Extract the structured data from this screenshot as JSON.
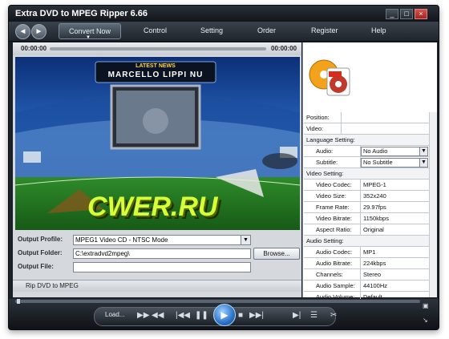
{
  "window": {
    "title": "Extra DVD to MPEG Ripper 6.66",
    "controls": {
      "minimize": "_",
      "maximize": "□",
      "close": "×"
    }
  },
  "menu": {
    "back_icon": "◄",
    "forward_icon": "►",
    "items": [
      {
        "label": "Convert Now"
      },
      {
        "label": "Control"
      },
      {
        "label": "Setting"
      },
      {
        "label": "Order"
      },
      {
        "label": "Register"
      },
      {
        "label": "Help"
      }
    ]
  },
  "player": {
    "time_start": "00:00:00",
    "time_end": "00:00:00",
    "news_banner_title": "LATEST NEWS",
    "news_banner_text": "MARCELLO LIPPI NU",
    "watermark_text": "CWER.RU"
  },
  "output": {
    "profile_label": "Output Profile:",
    "profile_value": "MPEG1  Video CD - NTSC Mode",
    "folder_label": "Output Folder:",
    "folder_value": "C:\\extradvd2mpeg\\",
    "file_label": "Output File:",
    "file_value": "",
    "browse_label": "Browse..."
  },
  "status": {
    "text": "Rip DVD to MPEG"
  },
  "properties": {
    "position_label": "Position:",
    "position_value": "",
    "video_label": "Video:",
    "video_value": "",
    "language_section": "Language Setting:",
    "audio_label": "Audio:",
    "audio_value": "No Audio",
    "subtitle_label": "Subtitle:",
    "subtitle_value": "No Subtitle",
    "video_section": "Video Setting:",
    "video_rows": [
      {
        "k": "Video Codec:",
        "v": "MPEG-1"
      },
      {
        "k": "Video Size:",
        "v": "352x240"
      },
      {
        "k": "Frame Rate:",
        "v": "29.97fps"
      },
      {
        "k": "Video Bitrate:",
        "v": "1150kbps"
      },
      {
        "k": "Aspect Ratio:",
        "v": "Original"
      }
    ],
    "audio_section": "Audio Setting:",
    "audio_rows": [
      {
        "k": "Audio Codec:",
        "v": "MP1"
      },
      {
        "k": "Audio Bitrate:",
        "v": "224kbps"
      },
      {
        "k": "Channels:",
        "v": "Stereo"
      },
      {
        "k": "Audio Sample:",
        "v": "44100Hz"
      },
      {
        "k": "Audio Volume:",
        "v": "Default"
      }
    ]
  },
  "transport": {
    "load_label": "Load...",
    "progress": 0.0
  },
  "colors": {
    "accent": "#2a73c9",
    "chrome": "#1c2128"
  }
}
